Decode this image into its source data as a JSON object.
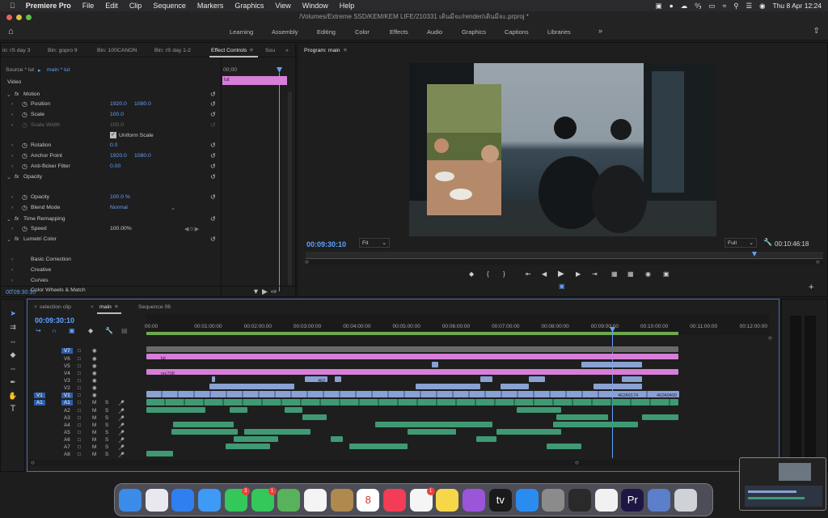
{
  "menubar": {
    "app": "Premiere Pro",
    "items": [
      "File",
      "Edit",
      "Clip",
      "Sequence",
      "Markers",
      "Graphics",
      "View",
      "Window",
      "Help"
    ],
    "clock": "Thu 8 Apr  12:24"
  },
  "titlebar": {
    "path": "/Volumes/Extreme SSD/KEM/KEM LIFE/210331 เดินมีจะ/render/เดินมีจะ.prproj *"
  },
  "workspaces": [
    "Learning",
    "Assembly",
    "Editing",
    "Color",
    "Effects",
    "Audio",
    "Graphics",
    "Captions",
    "Libraries"
  ],
  "source_tabs": [
    "in: rS day 3",
    "Bin: gopro 9",
    "Bin: 100CANON",
    "Bin: rS day 1-2",
    "Effect Controls",
    "Sou"
  ],
  "effect_controls": {
    "source": "Source * lut",
    "clip": "main * lut",
    "header_time": "00;00",
    "clip_bar": "lut",
    "video": "Video",
    "rows": [
      {
        "label": "Motion",
        "fx": true
      },
      {
        "label": "Position",
        "v1": "1920.0",
        "v2": "1080.0"
      },
      {
        "label": "Scale",
        "v1": "100.0"
      },
      {
        "label": "Scale Width",
        "v1": "100.0",
        "disabled": true
      },
      {
        "label": "Uniform Scale",
        "checkbox": true
      },
      {
        "label": "Rotation",
        "v1": "0.0"
      },
      {
        "label": "Anchor Point",
        "v1": "1920.0",
        "v2": "1080.0"
      },
      {
        "label": "Anti-flicker Filter",
        "v1": "0.00"
      },
      {
        "label": "Opacity",
        "fx": true
      },
      {
        "label": "Opacity",
        "v1": "100.0 %"
      },
      {
        "label": "Blend Mode",
        "v1": "Normal"
      },
      {
        "label": "Time Remapping",
        "fx": true
      },
      {
        "label": "Speed",
        "v1": "100.00%",
        "gray": true
      },
      {
        "label": "Lumetri Color",
        "fx": true
      },
      {
        "label": "Basic Correction"
      },
      {
        "label": "Creative"
      },
      {
        "label": "Curves"
      },
      {
        "label": "Color Wheels & Match"
      }
    ],
    "footer_time": "00:09:30:10"
  },
  "program": {
    "title": "Program: main",
    "timecode": "00:09:30:10",
    "fit": "Fit",
    "quality": "Full",
    "duration": "00:10:46:18"
  },
  "timeline": {
    "tabs": [
      "selection clip",
      "main",
      "Sequence 06"
    ],
    "timecode": "00:09:30:10",
    "ruler": [
      "00:00",
      "00:01:00:00",
      "00:02:00:00",
      "00:03:00:00",
      "00:04:00:00",
      "00:05:00:00",
      "00:06:00:00",
      "00:07:00:00",
      "00:08:00:00",
      "00:09:00:00",
      "00:10:00:00",
      "00:11:00:00",
      "00:12:00:00"
    ],
    "video_tracks": [
      "V7",
      "V6",
      "V5",
      "V4",
      "V3",
      "V2",
      "V1"
    ],
    "audio_tracks": [
      "A1",
      "A2",
      "A3",
      "A4",
      "A5",
      "A6",
      "A7",
      "A8"
    ],
    "clip_labels": {
      "lut": "lut",
      "rec709": "rec709",
      "c462": "462",
      "c1": "462A9174",
      "c2": "462A9400"
    }
  },
  "dock": [
    {
      "name": "finder-icon",
      "bg": "#3b8be8"
    },
    {
      "name": "launchpad-icon",
      "bg": "#e8e8ee"
    },
    {
      "name": "safari-icon",
      "bg": "#2f7ff0"
    },
    {
      "name": "mail-icon",
      "bg": "#3e9af5"
    },
    {
      "name": "facetime-icon",
      "bg": "#34c759",
      "badge": "3"
    },
    {
      "name": "messages-icon",
      "bg": "#34c759",
      "badge": "1"
    },
    {
      "name": "maps-icon",
      "bg": "#58b25b"
    },
    {
      "name": "photos-icon",
      "bg": "#f4f4f4"
    },
    {
      "name": "notes-app-icon",
      "bg": "#b0894f"
    },
    {
      "name": "calendar-icon",
      "bg": "#ffffff",
      "text": "8"
    },
    {
      "name": "music-icon",
      "bg": "#f33c55"
    },
    {
      "name": "reminders-icon",
      "bg": "#f5f5f5",
      "badge": "1"
    },
    {
      "name": "notes-icon",
      "bg": "#f7d74a"
    },
    {
      "name": "podcasts-icon",
      "bg": "#9a55d8"
    },
    {
      "name": "tv-icon",
      "bg": "#1a1a1a",
      "text": "tv"
    },
    {
      "name": "app-store-icon",
      "bg": "#2b8cf0"
    },
    {
      "name": "system-preferences-icon",
      "bg": "#8b8b8b"
    },
    {
      "name": "activity-monitor-icon",
      "bg": "#2a2a2a"
    },
    {
      "name": "chrome-icon",
      "bg": "#f1f1f1"
    },
    {
      "name": "premiere-icon",
      "bg": "#1e1745",
      "text": "Pr"
    },
    {
      "name": "preview-icon",
      "bg": "#5b7fc9"
    },
    {
      "name": "trash-icon",
      "bg": "#cfd3d8"
    }
  ]
}
